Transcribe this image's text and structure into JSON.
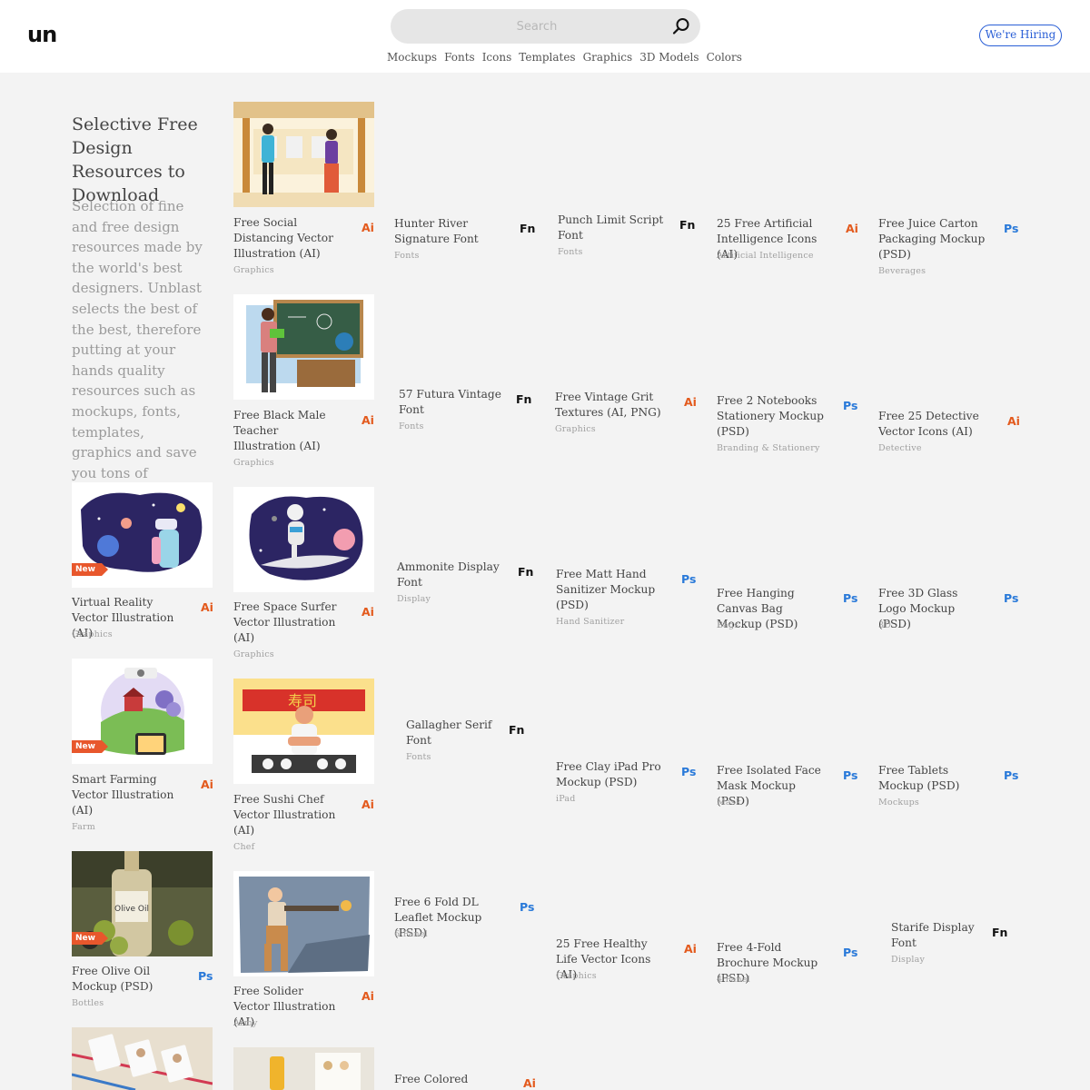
{
  "header": {
    "logo": "un",
    "search_placeholder": "Search",
    "nav": [
      "Mockups",
      "Fonts",
      "Icons",
      "Templates",
      "Graphics",
      "3D Models",
      "Colors"
    ],
    "hiring_label": "We're Hiring"
  },
  "intro": {
    "title": "Selective Free Design Resources to Download",
    "description": "Selection of fine and free design resources made by the world's best designers. Unblast selects the best of the best, therefore putting at your hands quality resources such as mockups, fonts, templates, graphics and save you tons of searching hours."
  },
  "new_label": "New",
  "items": [
    {
      "title": "Free Social Distancing Vector Illustration (AI)",
      "category": "Graphics",
      "badge": "Ai",
      "thumbnail": "social-distancing"
    },
    {
      "title": "Hunter River Signature Font",
      "category": "Fonts",
      "badge": "Fn"
    },
    {
      "title": "Punch Limit Script Font",
      "category": "Fonts",
      "badge": "Fn"
    },
    {
      "title": "25 Free Artificial Intelligence Icons (AI)",
      "category": "Artificial Intelligence",
      "badge": "Ai"
    },
    {
      "title": "Free Juice Carton Packaging Mockup (PSD)",
      "category": "Beverages",
      "badge": "Ps"
    },
    {
      "title": "Free Black Male Teacher Illustration (AI)",
      "category": "Graphics",
      "badge": "Ai",
      "thumbnail": "teacher"
    },
    {
      "title": "57 Futura Vintage Font",
      "category": "Fonts",
      "badge": "Fn"
    },
    {
      "title": "Free Vintage Grit Textures (AI, PNG)",
      "category": "Graphics",
      "badge": "Ai"
    },
    {
      "title": "Free 2 Notebooks Stationery Mockup (PSD)",
      "category": "Branding & Stationery",
      "badge": "Ps"
    },
    {
      "title": "Free 25 Detective Vector Icons (AI)",
      "category": "Detective",
      "badge": "Ai"
    },
    {
      "title": "Virtual Reality Vector Illustration (AI)",
      "category": "Graphics",
      "badge": "Ai",
      "thumbnail": "virtual-reality",
      "new": true
    },
    {
      "title": "Free Space Surfer Vector Illustration (AI)",
      "category": "Graphics",
      "badge": "Ai",
      "thumbnail": "space-surfer"
    },
    {
      "title": "Ammonite Display Font",
      "category": "Display",
      "badge": "Fn"
    },
    {
      "title": "Free Matt Hand Sanitizer Mockup (PSD)",
      "category": "Hand Sanitizer",
      "badge": "Ps"
    },
    {
      "title": "Free Hanging Canvas Bag Mockup (PSD)",
      "category": "Bags",
      "badge": "Ps"
    },
    {
      "title": "Free 3D Glass Logo Mockup (PSD)",
      "category": "3D",
      "badge": "Ps"
    },
    {
      "title": "Smart Farming Vector Illustration (AI)",
      "category": "Farm",
      "badge": "Ai",
      "thumbnail": "smart-farming",
      "new": true
    },
    {
      "title": "Free Sushi Chef Vector Illustration (AI)",
      "category": "Chef",
      "badge": "Ai",
      "thumbnail": "sushi-chef"
    },
    {
      "title": "Gallagher Serif Font",
      "category": "Fonts",
      "badge": "Fn"
    },
    {
      "title": "Free Clay iPad Pro Mockup (PSD)",
      "category": "iPad",
      "badge": "Ps"
    },
    {
      "title": "Free Isolated Face Mask Mockup (PSD)",
      "category": "Mask",
      "badge": "Ps"
    },
    {
      "title": "Free Tablets Mockup (PSD)",
      "category": "Mockups",
      "badge": "Ps"
    },
    {
      "title": "Free Olive Oil Mockup (PSD)",
      "category": "Bottles",
      "badge": "Ps",
      "thumbnail": "olive-oil",
      "new": true
    },
    {
      "title": "Free Solider Vector Illustration (AI)",
      "category": "Army",
      "badge": "Ai",
      "thumbnail": "soldier"
    },
    {
      "title": "Free 6 Fold DL Leaflet Mockup (PSD)",
      "category": "6 Panel",
      "badge": "Ps"
    },
    {
      "title": "25 Free Healthy Life Vector Icons (AI)",
      "category": "Graphics",
      "badge": "Ai"
    },
    {
      "title": "Free 4-Fold Brochure Mockup (PSD)",
      "category": "4 Panel",
      "badge": "Ps"
    },
    {
      "title": "Starife Display Font",
      "category": "Display",
      "badge": "Fn"
    },
    {
      "title": "Free Colored",
      "badge": "Ai"
    }
  ],
  "colors": {
    "accent_hiring": "#2a5fd6",
    "badge_ai": "#e35a1d",
    "badge_ps": "#2979d9",
    "new_badge": "#e8572c"
  }
}
